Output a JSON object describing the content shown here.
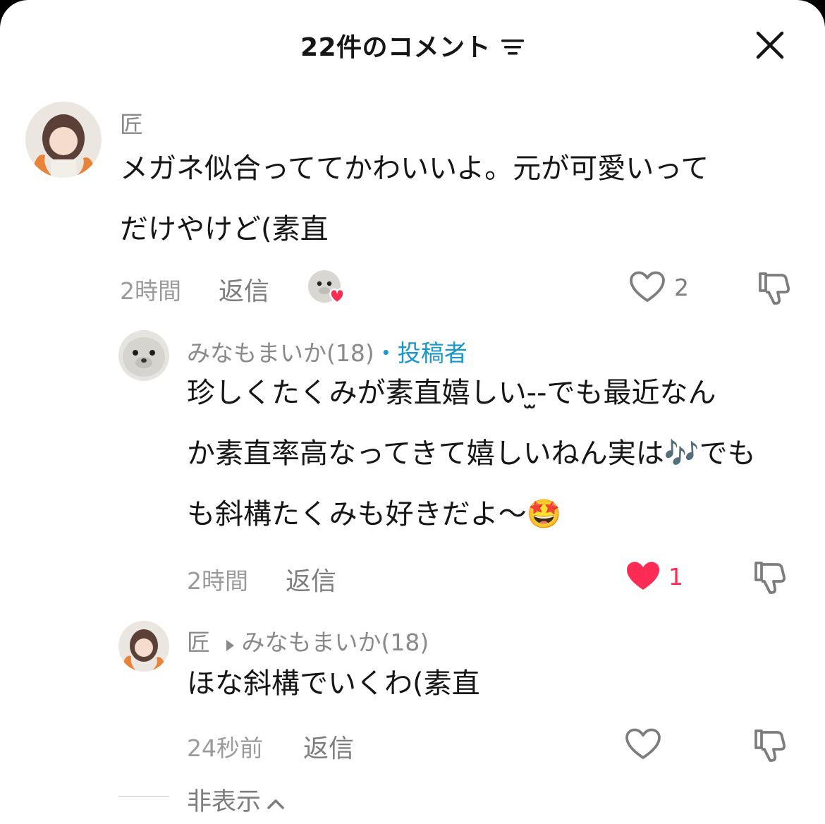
{
  "header": {
    "title": "22件のコメント"
  },
  "comments": [
    {
      "username": "匠",
      "text_line1": "メガネ似合っててかわいいよ。元が可愛いって",
      "text_line2": "だけやけど(素直",
      "time": "2時間",
      "reply_label": "返信",
      "like_count": "2",
      "liked_by_creator": true
    },
    {
      "username": "みなもまいか(18)",
      "author_separator": "・",
      "author_tag": "投稿者",
      "text_line1": "珍しくたくみが素直嬉しい-̫-でも最近なん",
      "text_line2": "か素直率高なってきて嬉しいねん実は🎶でも",
      "text_line3": "も斜構たくみも好きだよ〜🤩",
      "time": "2時間",
      "reply_label": "返信",
      "like_count": "1",
      "liked": true
    },
    {
      "username": "匠",
      "reply_to": "みなもまいか(18)",
      "text_line1": "ほな斜構でいくわ(素直",
      "time": "24秒前",
      "reply_label": "返信"
    }
  ],
  "hide_replies": {
    "label": "非表示"
  },
  "colors": {
    "accent": "#fe2c55",
    "author_tag": "#1a97c9"
  }
}
